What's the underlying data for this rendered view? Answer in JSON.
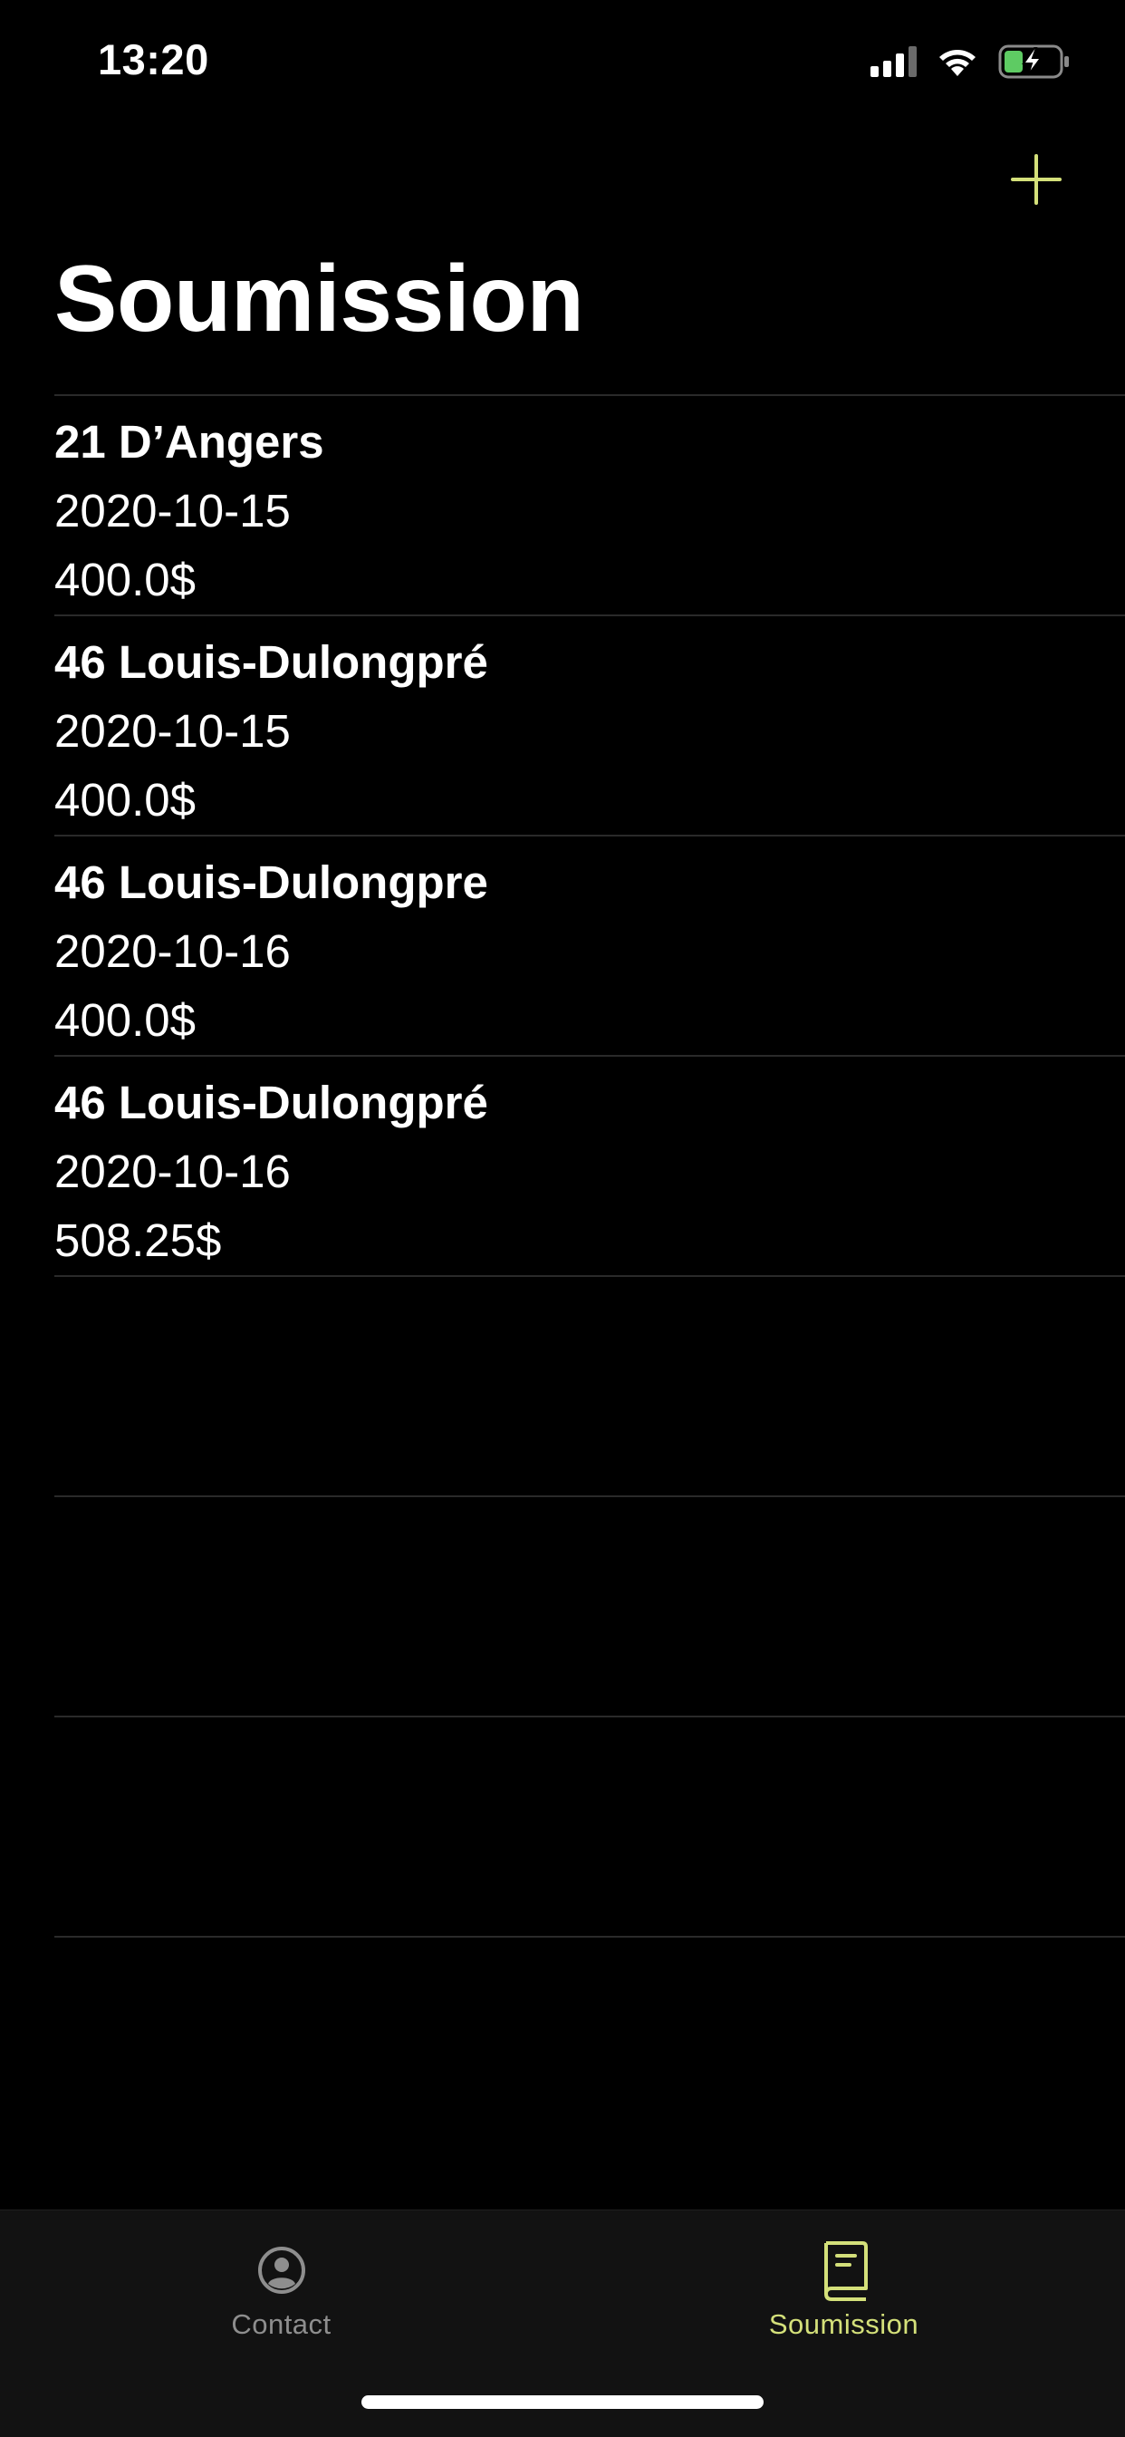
{
  "status_bar": {
    "time": "13:20",
    "icons": [
      "cellular-signal-icon",
      "wifi-icon",
      "battery-charging-icon"
    ]
  },
  "nav": {
    "add_icon": "plus-icon"
  },
  "title": "Soumission",
  "items": [
    {
      "title": "21 D’Angers",
      "date": "2020-10-15",
      "price": "400.0$"
    },
    {
      "title": "46 Louis-Dulongpré",
      "date": "2020-10-15",
      "price": "400.0$"
    },
    {
      "title": "46 Louis-Dulongpre",
      "date": "2020-10-16",
      "price": "400.0$"
    },
    {
      "title": "46 Louis-Dulongpré",
      "date": "2020-10-16",
      "price": "508.25$"
    }
  ],
  "tabs": [
    {
      "label": "Contact",
      "icon": "person-circle-icon",
      "active": false
    },
    {
      "label": "Soumission",
      "icon": "book-icon",
      "active": true
    }
  ],
  "colors": {
    "background": "#000000",
    "accent": "#d4e07a",
    "inactive": "#8e8e8e",
    "separator": "#2a2a2a",
    "tab_bar": "#121212",
    "battery_green": "#5ecb63"
  }
}
